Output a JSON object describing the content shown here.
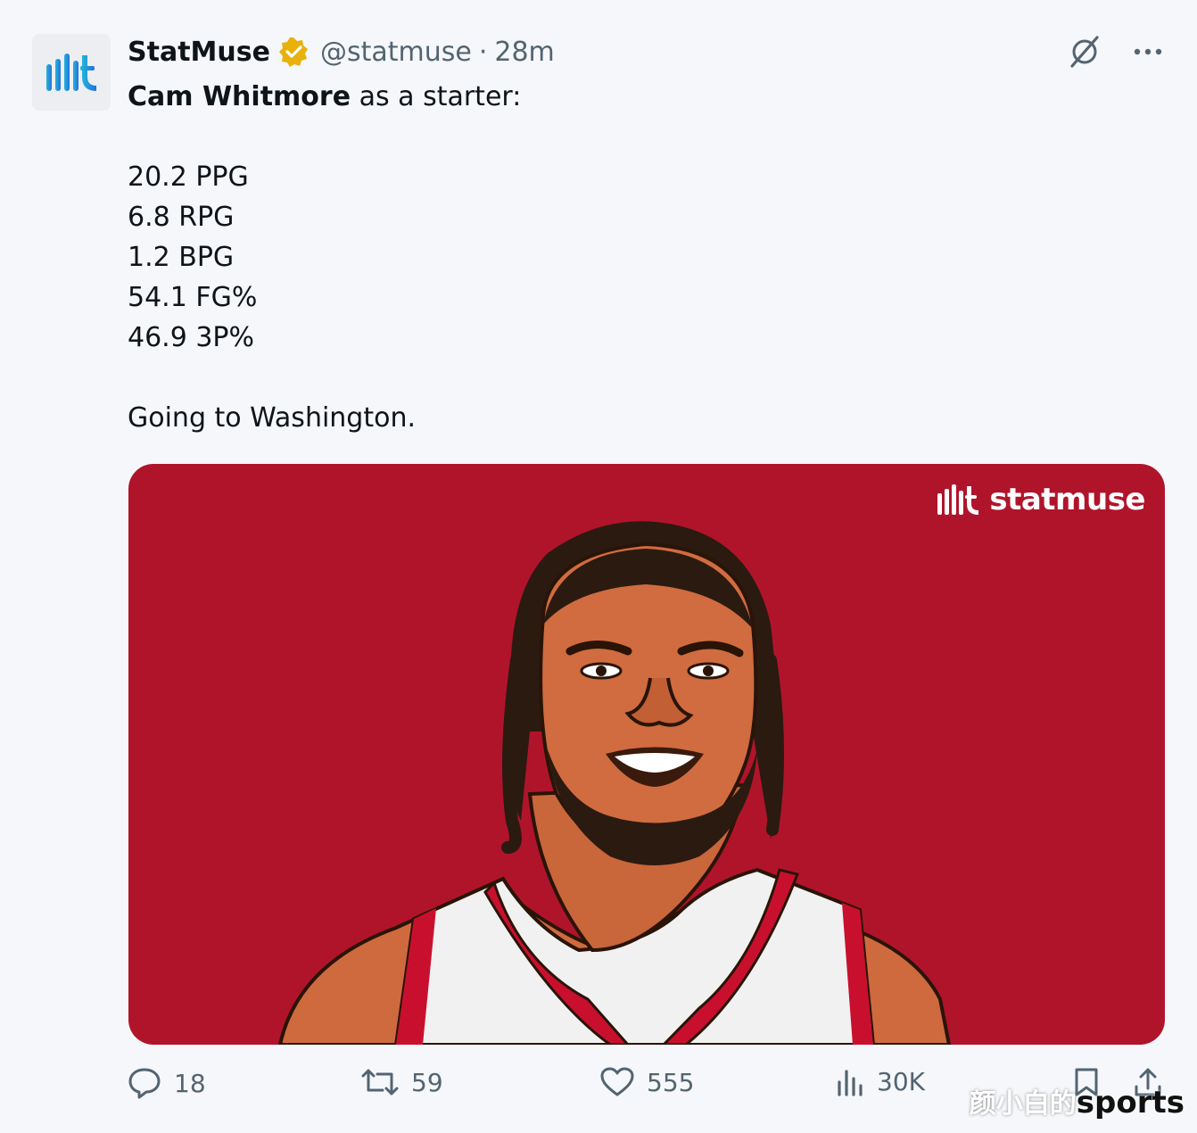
{
  "tweet": {
    "author_name": "StatMuse",
    "handle": "@statmuse",
    "separator": "·",
    "time": "28m",
    "headline_bold": "Cam Whitmore",
    "headline_rest": " as a starter:",
    "stats": [
      "20.2 PPG",
      "6.8 RPG",
      "1.2 BPG",
      "54.1 FG%",
      "46.9 3P%"
    ],
    "closing": "Going to Washington."
  },
  "media": {
    "brand_text": "statmuse",
    "background_color": "#b0142b",
    "jersey_color": "#c8102e"
  },
  "actions": {
    "replies": "18",
    "reposts": "59",
    "likes": "555",
    "views": "30K"
  },
  "watermark": {
    "cn_text": "颜小白的",
    "en_text": "sports"
  },
  "icons": [
    "statmuse-logo-icon",
    "verified-badge-icon",
    "grok-icon",
    "more-icon",
    "reply-icon",
    "repost-icon",
    "like-icon",
    "views-icon",
    "bookmark-icon",
    "share-icon"
  ]
}
